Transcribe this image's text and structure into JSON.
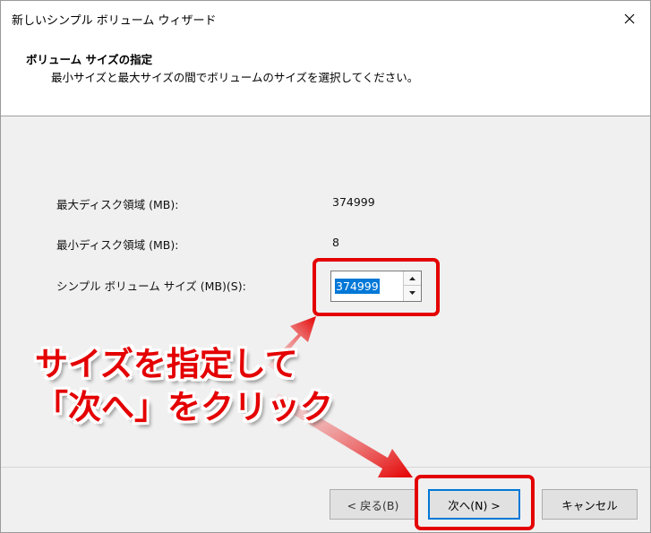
{
  "window": {
    "title": "新しいシンプル ボリューム ウィザード"
  },
  "header": {
    "title": "ボリューム サイズの指定",
    "description": "最小サイズと最大サイズの間でボリュームのサイズを選択してください。"
  },
  "fields": {
    "max_label": "最大ディスク領域 (MB):",
    "max_value": "374999",
    "min_label": "最小ディスク領域 (MB):",
    "min_value": "8",
    "size_label": "シンプル ボリューム サイズ (MB)(S):",
    "size_value": "374999"
  },
  "annotation": {
    "line1": "サイズを指定して",
    "line2": "「次へ」をクリック",
    "color": "#e40000"
  },
  "buttons": {
    "back": "< 戻る(B)",
    "next": "次へ(N) >",
    "cancel": "キャンセル"
  },
  "icons": {
    "close": "close-icon",
    "spin_up": "up-arrow-icon",
    "spin_down": "down-arrow-icon"
  }
}
